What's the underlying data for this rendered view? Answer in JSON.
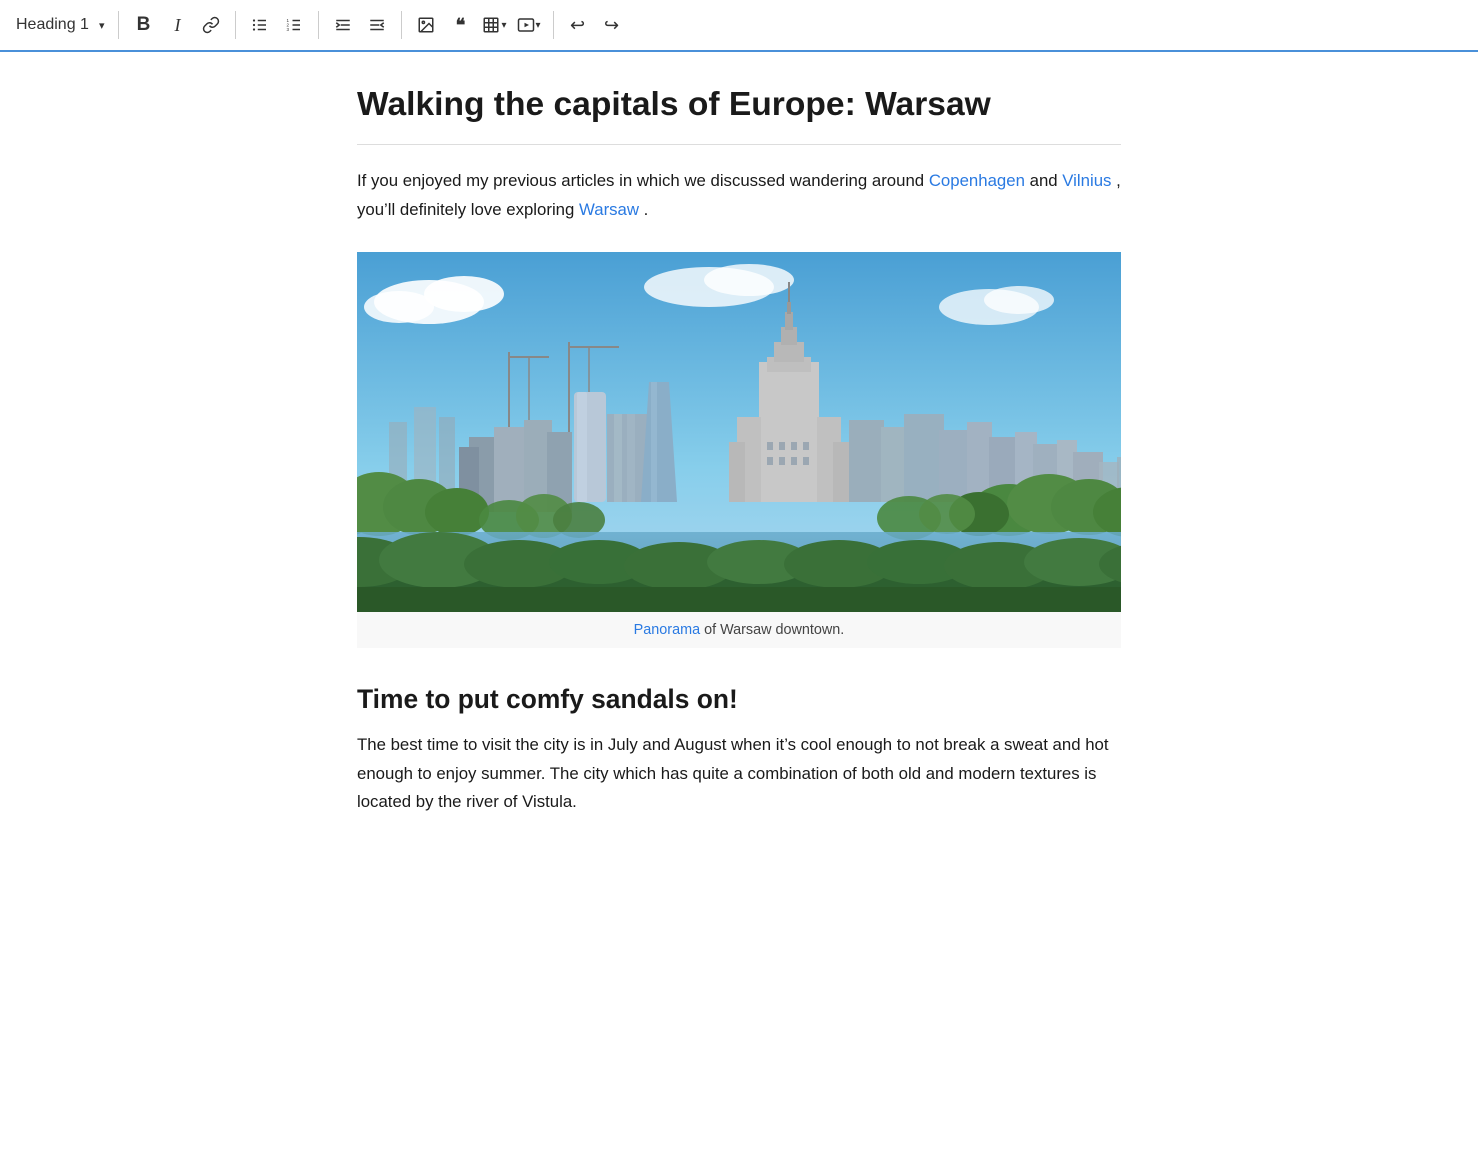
{
  "toolbar": {
    "heading_selector": "Heading 1",
    "chevron": "▾",
    "bold_label": "B",
    "italic_label": "I",
    "undo_label": "↩",
    "redo_label": "↪",
    "buttons": [
      {
        "name": "bold",
        "symbol": "B"
      },
      {
        "name": "italic",
        "symbol": "I"
      },
      {
        "name": "link",
        "symbol": "⊘"
      },
      {
        "name": "bullet-list",
        "symbol": "≔"
      },
      {
        "name": "numbered-list",
        "symbol": "⅟"
      },
      {
        "name": "indent-left",
        "symbol": "⇤"
      },
      {
        "name": "indent-right",
        "symbol": "⇥"
      },
      {
        "name": "image",
        "symbol": "🖼"
      },
      {
        "name": "quote",
        "symbol": "❝"
      },
      {
        "name": "table",
        "symbol": "⊞"
      },
      {
        "name": "media",
        "symbol": "▶"
      },
      {
        "name": "undo",
        "symbol": "↩"
      },
      {
        "name": "redo",
        "symbol": "↪"
      }
    ]
  },
  "article": {
    "title": "Walking the capitals of Europe:  Warsaw",
    "intro": "If you enjoyed my previous articles in which we discussed wandering around",
    "link1": "Copenhagen",
    "link1_href": "#",
    "intro_mid": " and ",
    "link2": "Vilnius",
    "link2_href": "#",
    "intro_end": ", you’ll definitely love exploring ",
    "link3": "Warsaw",
    "link3_href": "#",
    "intro_final": ".",
    "image_caption_link": "Panorama",
    "image_caption_text": " of Warsaw downtown.",
    "section_heading": "Time to put comfy sandals on!",
    "body_text": "The best time to visit the city is in July and August when it’s cool enough to not break a sweat and hot enough to enjoy summer. The city which has quite a combination of both old and modern textures is located by the river of Vistula."
  }
}
